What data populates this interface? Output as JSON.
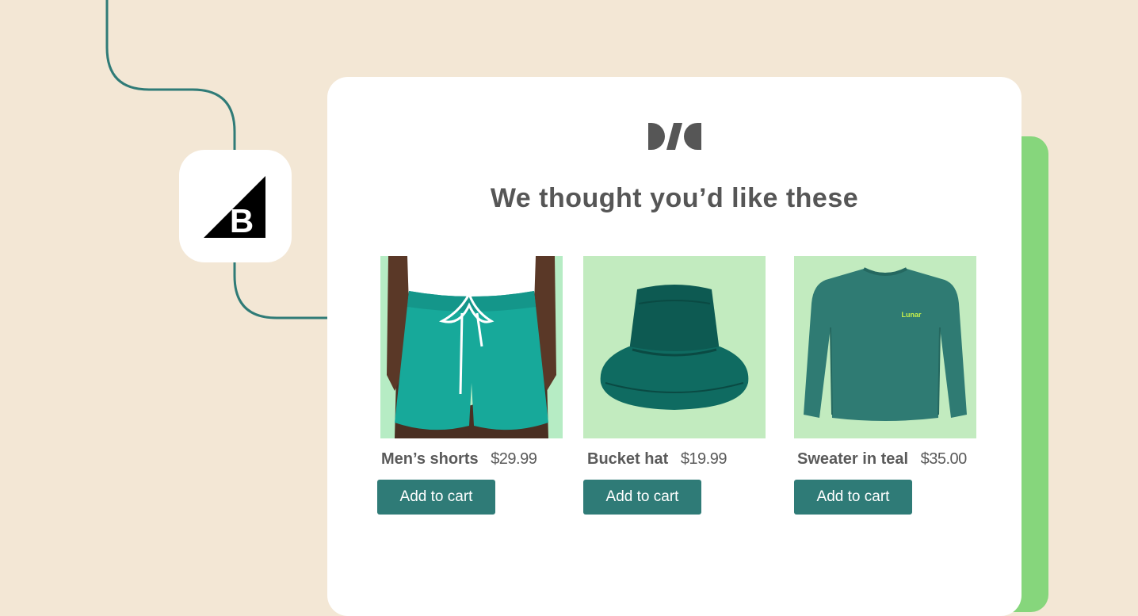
{
  "logo": {
    "icon": "bigcommerce-logo-icon",
    "letter": "B"
  },
  "card": {
    "brand_icon": "brand-mark-icon",
    "headline": "We thought you’d like these"
  },
  "products": [
    {
      "name": "Men’s shorts",
      "price": "$29.99",
      "cta": "Add to cart",
      "image_icon": "shorts-image"
    },
    {
      "name": "Bucket hat",
      "price": "$19.99",
      "cta": "Add to cart",
      "image_icon": "bucket-hat-image"
    },
    {
      "name": "Sweater in teal",
      "price": "$35.00",
      "cta": "Add to cart",
      "image_icon": "sweater-image",
      "sweater_print": "Lunar"
    }
  ],
  "colors": {
    "background": "#f3e7d5",
    "connector_line": "#2f7b77",
    "button": "#2f7b77",
    "accent_green": "#86d67c",
    "product_bg": "#c2ebbf",
    "heading_text": "#565656"
  }
}
